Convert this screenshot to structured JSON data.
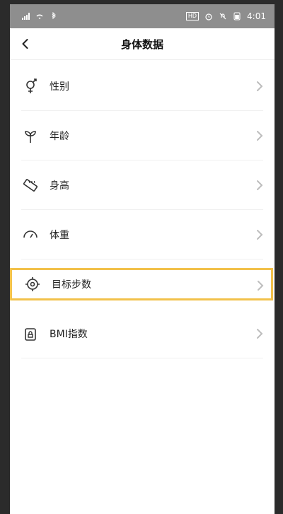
{
  "status": {
    "time": "4:01",
    "network_icon": "hd-badge",
    "icons": [
      "signal-icon",
      "wifi-icon",
      "bluetooth-icon",
      "hd-badge",
      "alarm-icon",
      "mute-icon",
      "battery-icon"
    ]
  },
  "header": {
    "title": "身体数据",
    "back_icon": "chevron-left-icon"
  },
  "items": [
    {
      "label": "性别",
      "icon": "gender-icon"
    },
    {
      "label": "年龄",
      "icon": "sprout-icon"
    },
    {
      "label": "身高",
      "icon": "ruler-icon"
    },
    {
      "label": "体重",
      "icon": "scale-icon"
    },
    {
      "label": "目标步数",
      "icon": "target-icon",
      "highlighted": true
    },
    {
      "label": "BMI指数",
      "icon": "lock-icon"
    }
  ],
  "colors": {
    "highlight_border": "#f2c14a",
    "status_bar": "#8e8e8e",
    "text_primary": "#222222",
    "chevron": "#bdbdbd"
  }
}
